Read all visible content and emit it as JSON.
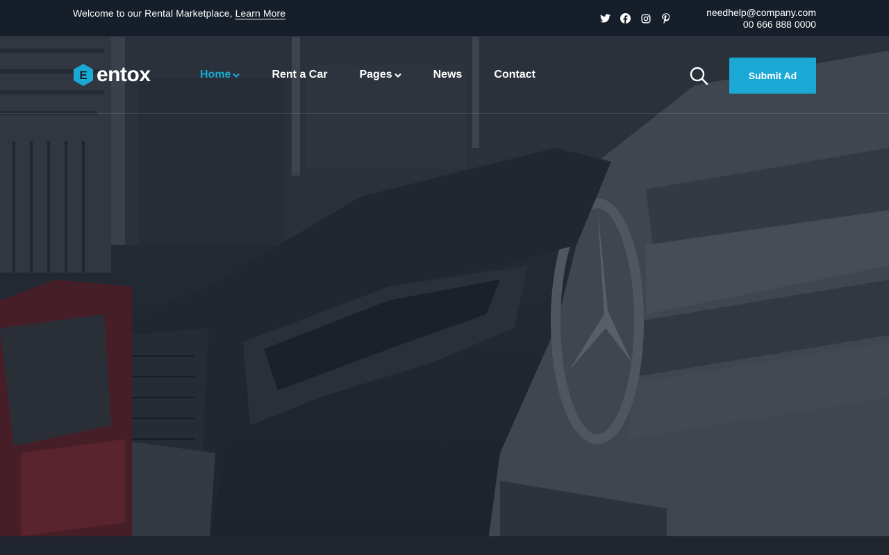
{
  "topbar": {
    "welcome_text": "Welcome to our Rental Marketplace,",
    "learn_more": "Learn More",
    "email": "needhelp@company.com",
    "phone": "00 666 888 0000",
    "socials": [
      "twitter-icon",
      "facebook-icon",
      "instagram-icon",
      "pinterest-icon"
    ]
  },
  "header": {
    "logo_text": "entox",
    "logo_letter": "E",
    "nav": [
      {
        "label": "Home",
        "has_dropdown": true,
        "active": true
      },
      {
        "label": "Rent a Car",
        "has_dropdown": false,
        "active": false
      },
      {
        "label": "Pages",
        "has_dropdown": true,
        "active": false
      },
      {
        "label": "News",
        "has_dropdown": false,
        "active": false
      },
      {
        "label": "Contact",
        "has_dropdown": false,
        "active": false
      }
    ],
    "submit_label": "Submit Ad"
  },
  "colors": {
    "accent": "#1aa9d4",
    "topbar_bg": "#151e29",
    "text": "#ffffff"
  }
}
